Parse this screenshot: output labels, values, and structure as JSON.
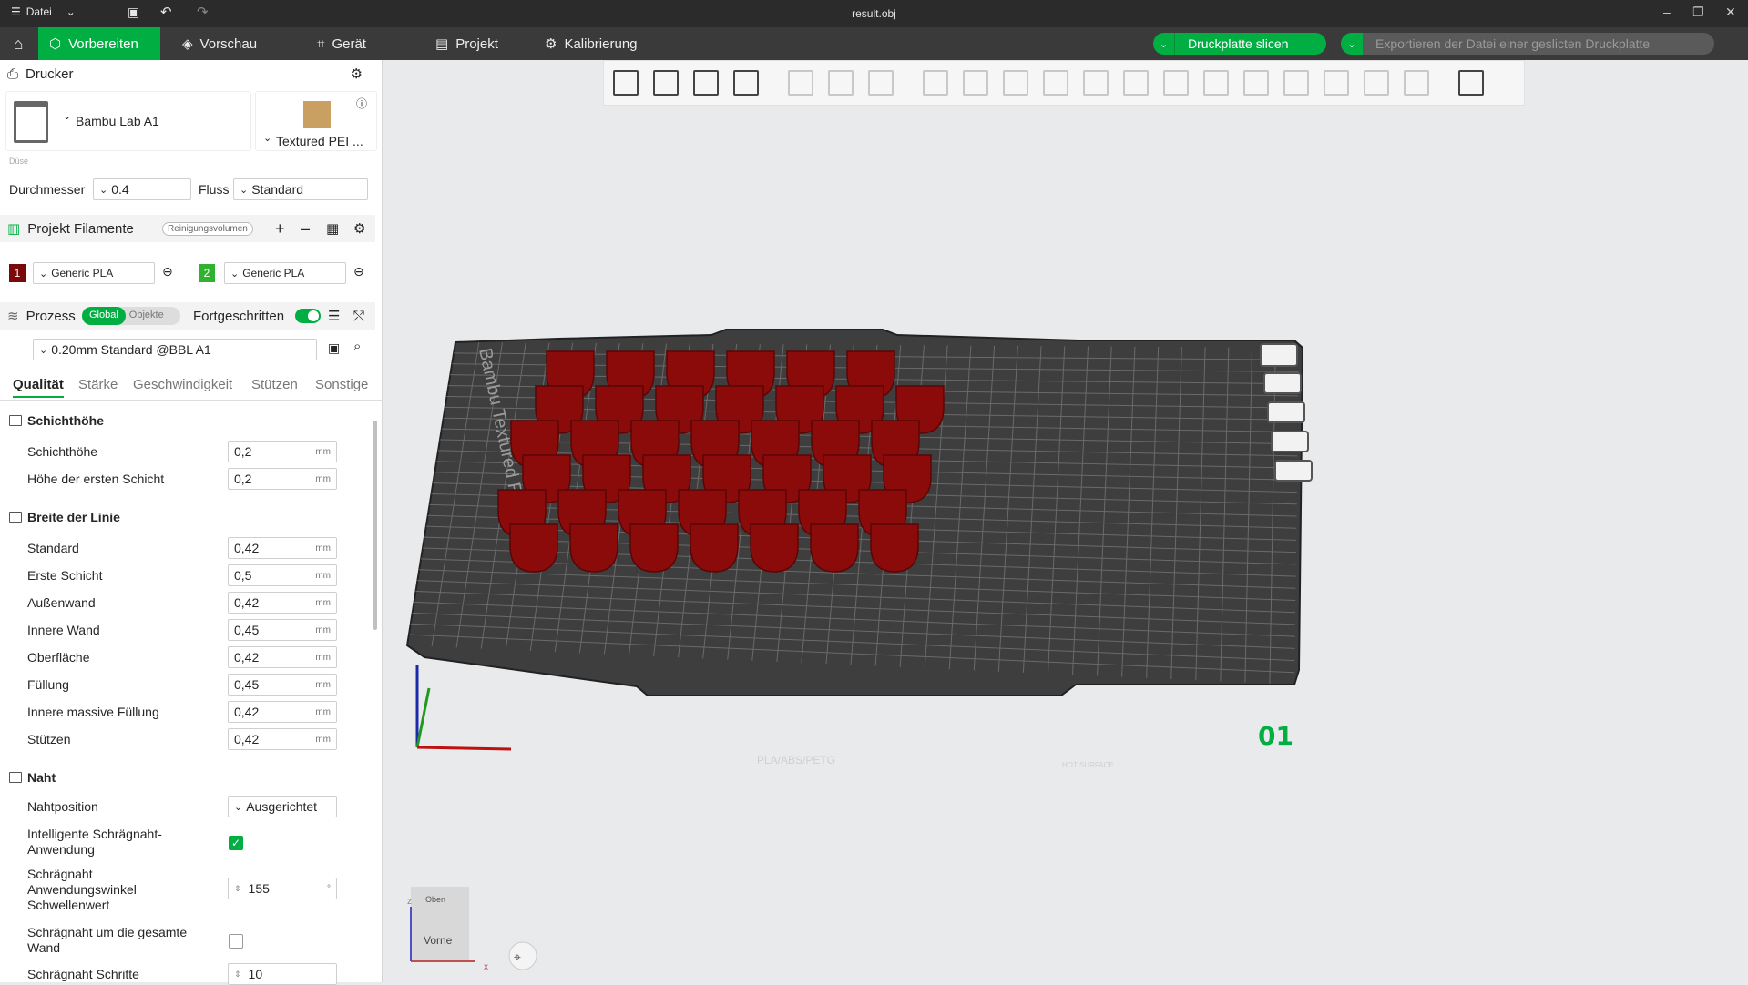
{
  "titlebar": {
    "menu_label": "Datei",
    "title": "result.obj"
  },
  "tabs": [
    {
      "label": "Vorbereiten"
    },
    {
      "label": "Vorschau"
    },
    {
      "label": "Gerät"
    },
    {
      "label": "Projekt"
    },
    {
      "label": "Kalibrierung"
    }
  ],
  "actions": {
    "slice": "Druckplatte slicen",
    "export": "Exportieren der Datei einer geslicten Druckplatte"
  },
  "printer": {
    "section": "Drucker",
    "name": "Bambu Lab A1",
    "plate": "Textured PEI ...",
    "nozzle_label": "Düse",
    "diameter_label": "Durchmesser",
    "diameter": "0.4",
    "flow_label": "Fluss",
    "flow": "Standard"
  },
  "filament": {
    "section": "Projekt Filamente",
    "purge_button": "Reinigungsvolumen",
    "slots": [
      {
        "num": "1",
        "name": "Generic PLA",
        "color": "#7a0a0a"
      },
      {
        "num": "2",
        "name": "Generic PLA",
        "color": "#2fb32f"
      }
    ]
  },
  "process": {
    "section": "Prozess",
    "global": "Global",
    "objects": "Objekte",
    "advanced": "Fortgeschritten",
    "preset": "0.20mm Standard @BBL A1",
    "tabs": [
      "Qualität",
      "Stärke",
      "Geschwindigkeit",
      "Stützen",
      "Sonstige"
    ]
  },
  "groups": {
    "layer": {
      "title": "Schichthöhe",
      "rows": [
        {
          "label": "Schichthöhe",
          "value": "0,2",
          "unit": "mm"
        },
        {
          "label": "Höhe der ersten Schicht",
          "value": "0,2",
          "unit": "mm"
        }
      ]
    },
    "width": {
      "title": "Breite der Linie",
      "rows": [
        {
          "label": "Standard",
          "value": "0,42",
          "unit": "mm"
        },
        {
          "label": "Erste Schicht",
          "value": "0,5",
          "unit": "mm"
        },
        {
          "label": "Außenwand",
          "value": "0,42",
          "unit": "mm"
        },
        {
          "label": "Innere Wand",
          "value": "0,45",
          "unit": "mm"
        },
        {
          "label": "Oberfläche",
          "value": "0,42",
          "unit": "mm"
        },
        {
          "label": "Füllung",
          "value": "0,45",
          "unit": "mm"
        },
        {
          "label": "Innere massive Füllung",
          "value": "0,42",
          "unit": "mm"
        },
        {
          "label": "Stützen",
          "value": "0,42",
          "unit": "mm"
        }
      ]
    },
    "seam": {
      "title": "Naht",
      "position_label": "Nahtposition",
      "position_value": "Ausgerichtet",
      "smart_label": "Intelligente Schrägnaht-Anwendung",
      "smart_checked": true,
      "angle_label": "Schrägnaht Anwendungswinkel Schwellenwert",
      "angle_value": "155",
      "angle_unit": "°",
      "whole_label": "Schrägnaht um die gesamte Wand",
      "whole_checked": false,
      "steps_label": "Schrägnaht Schritte",
      "steps_value": "10"
    }
  },
  "scene": {
    "plate_text": "Bambu Textured PEI Plate",
    "plate_number": "01",
    "bottom_text": "PLA/ABS/PETG",
    "surface_text": "HOT SURFACE",
    "cube_top": "Oben",
    "cube_front": "Vorne",
    "axis_x": "x",
    "axis_z": "z",
    "model_color": "#8b0b0b",
    "bed_color": "#4a4a4a"
  }
}
